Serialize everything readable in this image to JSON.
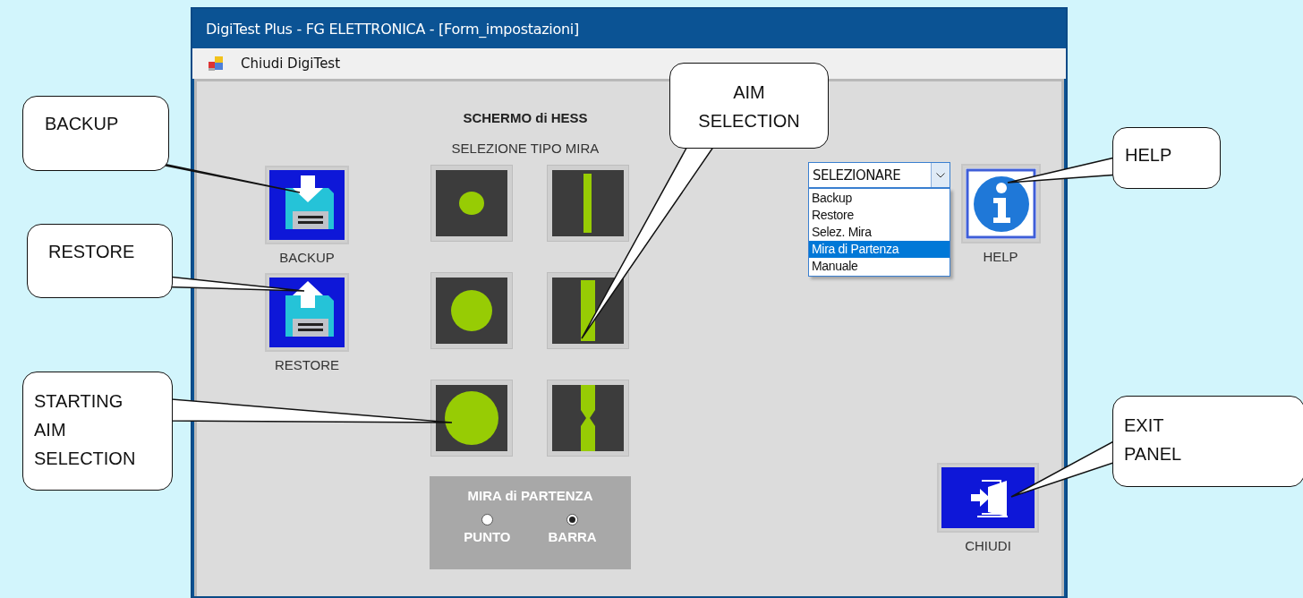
{
  "window": {
    "title": "DigiTest Plus - FG ELETTRONICA - [Form_impostazioni]"
  },
  "menu": [
    {
      "label": "Chiudi DigiTest"
    }
  ],
  "form": {
    "heading": "SCHERMO di HESS",
    "subheading": "SELEZIONE TIPO MIRA",
    "file_buttons": [
      {
        "kind": "backup",
        "label": "BACKUP"
      },
      {
        "kind": "restore",
        "label": "RESTORE"
      }
    ],
    "aim_tiles": [
      {
        "kind": "dot-small"
      },
      {
        "kind": "bar-thin"
      },
      {
        "kind": "dot-medium"
      },
      {
        "kind": "bar-wide"
      },
      {
        "kind": "dot-large"
      },
      {
        "kind": "bar-notched"
      }
    ],
    "start_aim": {
      "title": "MIRA di PARTENZA",
      "options": [
        {
          "label": "PUNTO",
          "selected": false
        },
        {
          "label": "BARRA",
          "selected": true
        }
      ]
    },
    "combo": {
      "value": "SELEZIONARE",
      "expanded": true,
      "items": [
        {
          "label": "Backup",
          "selected": false
        },
        {
          "label": "Restore",
          "selected": false
        },
        {
          "label": "Selez. Mira",
          "selected": false
        },
        {
          "label": "Mira di Partenza",
          "selected": true
        },
        {
          "label": "Manuale",
          "selected": false
        }
      ]
    },
    "help": {
      "label": "HELP"
    },
    "exit": {
      "label": "CHIUDI"
    }
  },
  "callouts": [
    {
      "text": "BACKUP"
    },
    {
      "text": "RESTORE"
    },
    {
      "text": "STARTING AIM SELECTION"
    },
    {
      "text": "AIM SELECTION"
    },
    {
      "text": "HELP"
    },
    {
      "text": "EXIT PANEL"
    }
  ]
}
